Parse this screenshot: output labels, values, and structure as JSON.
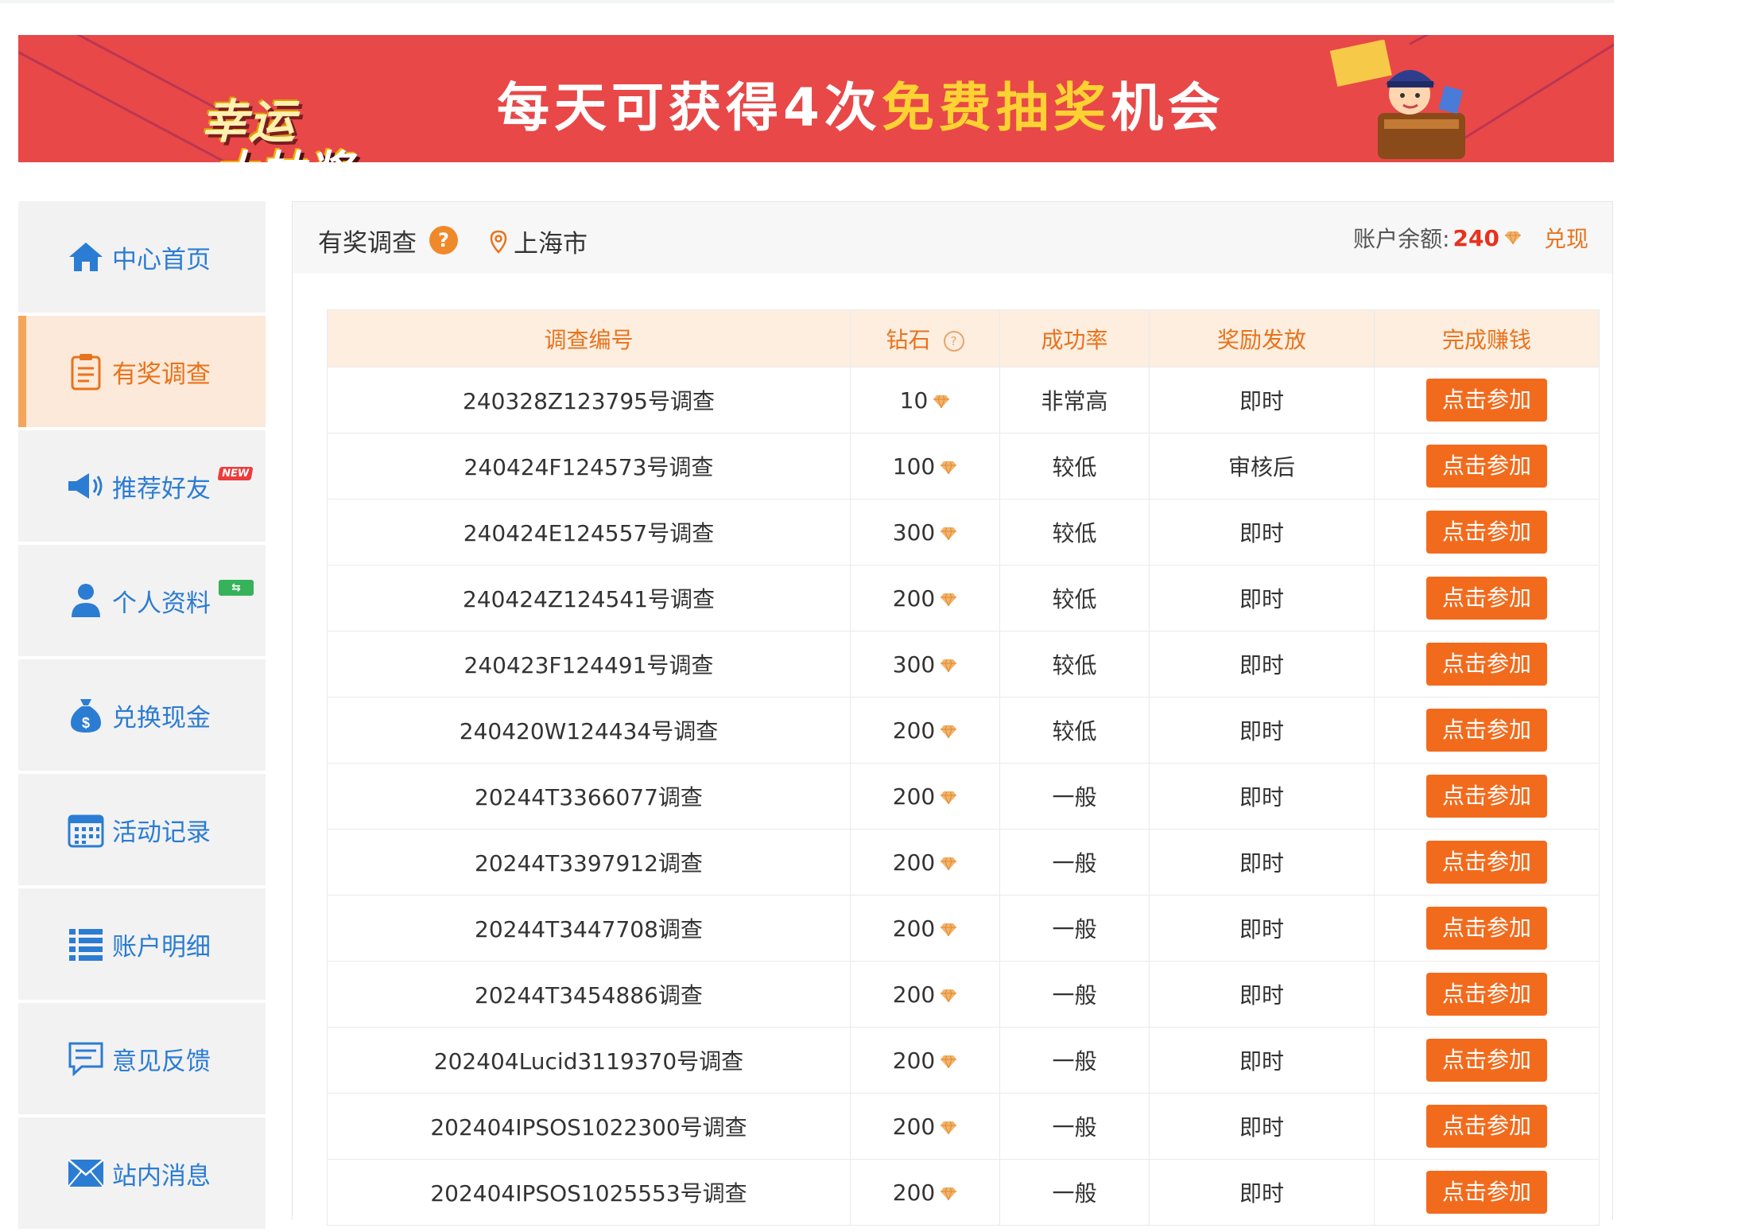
{
  "banner": {
    "logo_line1": "幸运",
    "logo_line2": "大抽奖",
    "title_pre": "每天可获得4次",
    "title_highlight": "免费抽奖",
    "title_post": "机会"
  },
  "sidebar": {
    "items": [
      {
        "label": "中心首页",
        "icon": "home-icon"
      },
      {
        "label": "有奖调查",
        "icon": "clipboard-icon"
      },
      {
        "label": "推荐好友",
        "icon": "megaphone-icon",
        "badge": "NEW"
      },
      {
        "label": "个人资料",
        "icon": "user-icon"
      },
      {
        "label": "兑换现金",
        "icon": "money-bag-icon"
      },
      {
        "label": "活动记录",
        "icon": "calendar-icon"
      },
      {
        "label": "账户明细",
        "icon": "list-icon"
      },
      {
        "label": "意见反馈",
        "icon": "feedback-icon"
      },
      {
        "label": "站内消息",
        "icon": "mail-icon"
      }
    ]
  },
  "header": {
    "title": "有奖调查",
    "help": "?",
    "location": "上海市",
    "balance_label": "账户余额:",
    "balance_value": "240",
    "withdraw": "兑现"
  },
  "table": {
    "columns": [
      "调查编号",
      "钻石",
      "成功率",
      "奖励发放",
      "完成赚钱"
    ],
    "column_help": "?",
    "button_label": "点击参加",
    "rows": [
      {
        "id": "240328Z123795号调查",
        "diamonds": "10",
        "rate": "非常高",
        "payout": "即时"
      },
      {
        "id": "240424F124573号调查",
        "diamonds": "100",
        "rate": "较低",
        "payout": "审核后"
      },
      {
        "id": "240424E124557号调查",
        "diamonds": "300",
        "rate": "较低",
        "payout": "即时"
      },
      {
        "id": "240424Z124541号调查",
        "diamonds": "200",
        "rate": "较低",
        "payout": "即时"
      },
      {
        "id": "240423F124491号调查",
        "diamonds": "300",
        "rate": "较低",
        "payout": "即时"
      },
      {
        "id": "240420W124434号调查",
        "diamonds": "200",
        "rate": "较低",
        "payout": "即时"
      },
      {
        "id": "20244T3366077调查",
        "diamonds": "200",
        "rate": "一般",
        "payout": "即时"
      },
      {
        "id": "20244T3397912调查",
        "diamonds": "200",
        "rate": "一般",
        "payout": "即时"
      },
      {
        "id": "20244T3447708调查",
        "diamonds": "200",
        "rate": "一般",
        "payout": "即时"
      },
      {
        "id": "20244T3454886调查",
        "diamonds": "200",
        "rate": "一般",
        "payout": "即时"
      },
      {
        "id": "202404Lucid3119370号调查",
        "diamonds": "200",
        "rate": "一般",
        "payout": "即时"
      },
      {
        "id": "202404IPSOS1022300号调查",
        "diamonds": "200",
        "rate": "一般",
        "payout": "即时"
      },
      {
        "id": "202404IPSOS1025553号调查",
        "diamonds": "200",
        "rate": "一般",
        "payout": "即时"
      }
    ]
  },
  "colors": {
    "accent_orange": "#f26b1d",
    "banner_red": "#e84848",
    "link_blue": "#2b7cd3",
    "balance_red": "#e8311c"
  }
}
